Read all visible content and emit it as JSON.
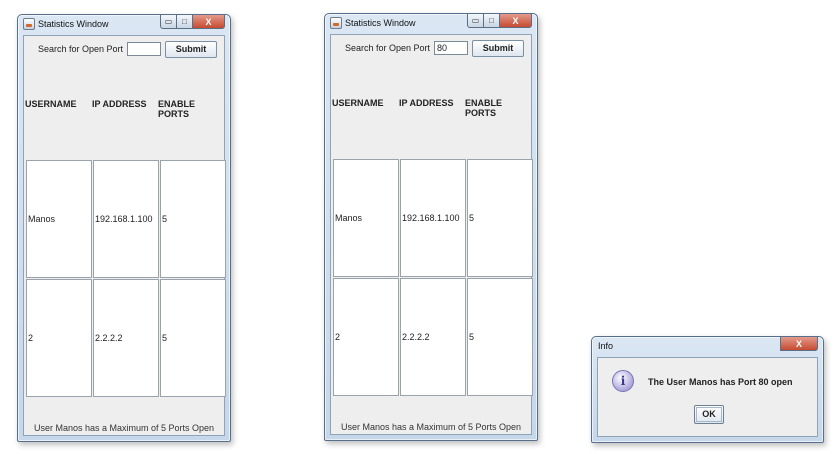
{
  "windows": [
    {
      "title": "Statistics Window",
      "search_label": "Search for Open Port",
      "port_value": "",
      "submit_label": "Submit",
      "columns": [
        "USERNAME",
        "IP ADDRESS",
        "ENABLE PORTS"
      ],
      "rows": [
        [
          "Manos",
          "192.168.1.100",
          "5"
        ],
        [
          "2",
          "2.2.2.2",
          "5"
        ]
      ],
      "footer": "User Manos has a Maximum of 5 Ports Open"
    },
    {
      "title": "Statistics Window",
      "search_label": "Search for Open Port",
      "port_value": "80",
      "submit_label": "Submit",
      "columns": [
        "USERNAME",
        "IP ADDRESS",
        "ENABLE PORTS"
      ],
      "rows": [
        [
          "Manos",
          "192.168.1.100",
          "5"
        ],
        [
          "2",
          "2.2.2.2",
          "5"
        ]
      ],
      "footer": "User Manos has a Maximum of 5 Ports Open"
    }
  ],
  "caption_buttons": {
    "minimize": "▭",
    "maximize": "□",
    "close": "X"
  },
  "dialog": {
    "title": "Info",
    "icon_glyph": "i",
    "message": "The User Manos has Port 80 open",
    "ok_label": "OK",
    "close": "X"
  },
  "icons": [
    "window-icon",
    "minimize-icon",
    "maximize-icon",
    "close-icon",
    "info-icon"
  ]
}
